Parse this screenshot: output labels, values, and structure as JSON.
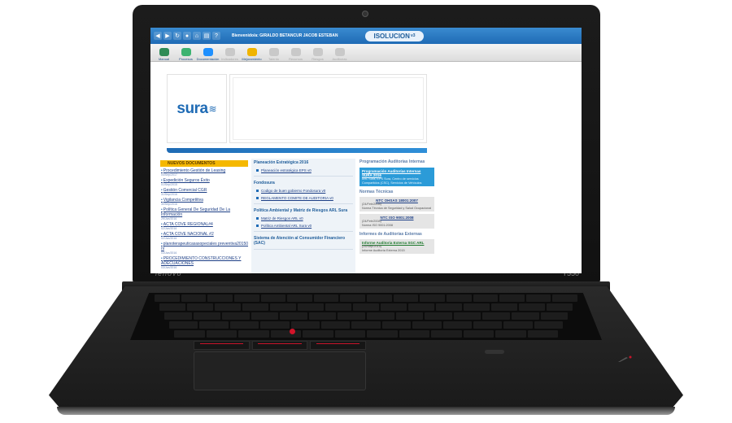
{
  "device": {
    "brand": "lenovo",
    "model": "T550"
  },
  "app": {
    "welcome": "Bienvenido/a: GIRALDO BETANCUR JACOB ESTEBAN",
    "product": "ISOLUCION",
    "product_version": "v3"
  },
  "toolbar": [
    {
      "label": "Manual",
      "color": "#2e8b57"
    },
    {
      "label": "Procesos",
      "color": "#3cb371"
    },
    {
      "label": "Documentación",
      "color": "#1e90ff"
    },
    {
      "label": "Indicadores",
      "color": "#c9c9c9"
    },
    {
      "label": "Mejoramiento",
      "color": "#f0b400"
    },
    {
      "label": "Talento",
      "color": "#c9c9c9"
    },
    {
      "label": "Recursos",
      "color": "#c9c9c9"
    },
    {
      "label": "Riesgos",
      "color": "#c9c9c9"
    },
    {
      "label": "Auditorías",
      "color": "#c9c9c9"
    }
  ],
  "logo": {
    "text": "sura"
  },
  "new_docs": {
    "header": "NUEVOS DOCUMENTOS",
    "items": [
      {
        "title": "Procedimiento Gestión de Leasing",
        "date": "04/Sep/2017"
      },
      {
        "title": "Expedición Seguros Éxito",
        "date": "01/Sep/2015"
      },
      {
        "title": "Gestión Comercial CGR",
        "date": "31/Sep/2016"
      },
      {
        "title": "Vigilancia Competitiva",
        "date": "30/Sep/2016"
      },
      {
        "title": "Política General De Seguridad De La Información",
        "date": "29/Jun/2016"
      },
      {
        "title": "ACTA COVE REGIONAL#4",
        "date": "02/Jun/2016"
      },
      {
        "title": "ACTA COVE NACIONAL #2",
        "date": "02/Jun/2016"
      },
      {
        "title": "planoterapeuticasasopeciales preventiva20150 nl",
        "date": "03/Jun/2016"
      },
      {
        "title": "PROCEDIMIENTO CONSTRUCCIONES Y ADECUACIONES",
        "date": "03/Jun/2016"
      }
    ]
  },
  "middle": {
    "sections": [
      {
        "title": "Planeación Estratégica 2016",
        "items": [
          "Planeación estratégica EPS  v0"
        ]
      },
      {
        "title": "Fondosura",
        "items": [
          "Codigo de buen gobierno Fondosura  v0",
          "REGLAMENTO COMITE DE AUDITORIA  v0"
        ]
      },
      {
        "title": "Política Ambiental y Matriz de Riesgos ARL Sura",
        "items": [
          "Matriz de Riesgos ARL  v0",
          "Política Ambiental ARL Sura  v0"
        ]
      },
      {
        "title": "Sistema de Atención al Consumidor Financiero (SAC)",
        "items": []
      }
    ]
  },
  "right": {
    "internal_audit_head": "Programación Auditorías Internas",
    "internal_audit": {
      "title": "Programación Auditorías Internas SURA 2016",
      "desc": "ARL Sura, EPS Sura, Centro de servicios Compartidos (CSC), Servicios de Vehículos"
    },
    "norms_head": "Normas Técnicas",
    "norms": [
      {
        "title": "NTC OHSAS 18001:2007",
        "date": "(24/Feb/2008)",
        "desc": "Norma Técnica de Seguridad y Salud Ocupacional"
      },
      {
        "title": "NTC ISO 9001:2008",
        "date": "(24/Feb/2008)",
        "desc": "Norma ISO 9001:2008"
      }
    ],
    "external_head": "Informes de Auditorías Externas",
    "external": {
      "title": "Informe Auditoria Externa SGC ARL",
      "date": "(25/Sep/2015)",
      "desc": "Informe Auditoría Externa 2015"
    }
  }
}
